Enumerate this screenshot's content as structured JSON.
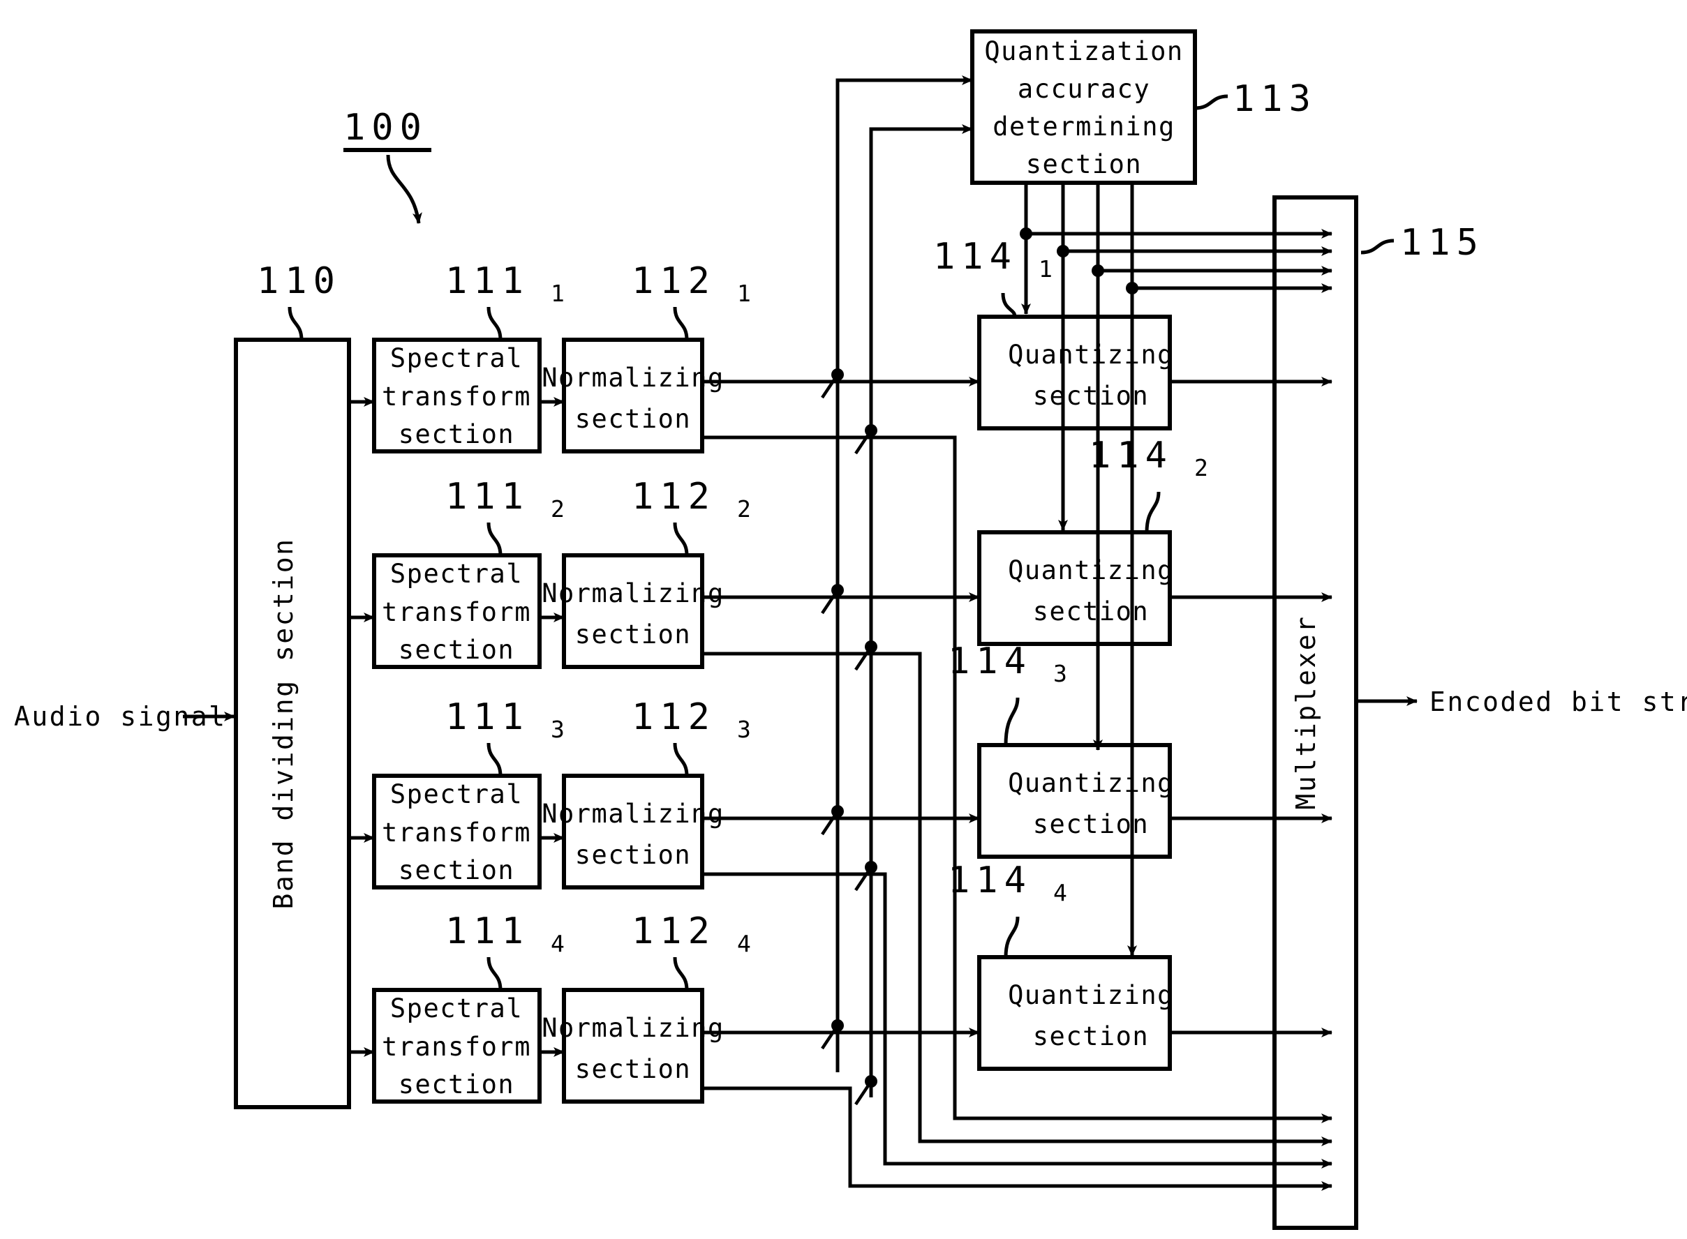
{
  "figure": {
    "ref_main": "100",
    "input_label": "Audio signal",
    "output_label": "Encoded bit stream"
  },
  "blocks": {
    "band_dividing": {
      "ref": "110",
      "lines": [
        "Band dividing section"
      ]
    },
    "spectral": {
      "lines": [
        "Spectral",
        "transform",
        "section"
      ],
      "refs": [
        "111",
        "111",
        "111",
        "111"
      ],
      "subs": [
        "1",
        "2",
        "3",
        "4"
      ]
    },
    "normalizing": {
      "lines": [
        "Normalizing",
        "section"
      ],
      "refs": [
        "112",
        "112",
        "112",
        "112"
      ],
      "subs": [
        "1",
        "2",
        "3",
        "4"
      ]
    },
    "quant_accuracy": {
      "ref": "113",
      "lines": [
        "Quantization",
        "accuracy",
        "determining",
        "section"
      ]
    },
    "quantizing": {
      "lines": [
        "Quantizing",
        "section"
      ],
      "refs": [
        "114",
        "114",
        "114",
        "114"
      ],
      "subs": [
        "1",
        "2",
        "3",
        "4"
      ]
    },
    "multiplexer": {
      "ref": "115",
      "lines": [
        "Multiplexer"
      ]
    }
  },
  "colors": {
    "ink": "#000000",
    "paper": "#ffffff"
  }
}
